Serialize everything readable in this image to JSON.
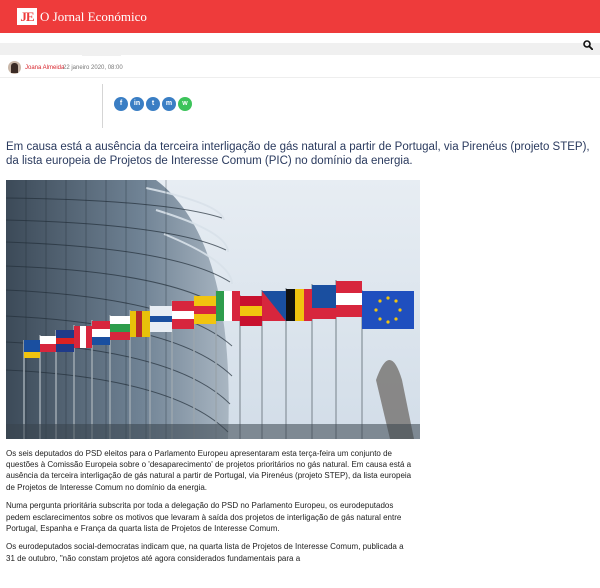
{
  "site": {
    "logo_mark": "JE",
    "name": "O Jornal Económico",
    "brand_color": "#ee3b3b"
  },
  "header": {
    "search_icon": "search-icon"
  },
  "article": {
    "author": "Joana Almeida",
    "date": "22 janeiro 2020, 08:00",
    "share": [
      {
        "icon": "facebook-icon",
        "glyph": "f"
      },
      {
        "icon": "linkedin-icon",
        "glyph": "in"
      },
      {
        "icon": "twitter-icon",
        "glyph": "t"
      },
      {
        "icon": "messenger-icon",
        "glyph": "m"
      },
      {
        "icon": "whatsapp-icon",
        "glyph": "w"
      }
    ],
    "lead": "Em causa está a ausência da terceira interligação de gás natural a partir de Portugal, via Pirenéus (projeto STEP), da lista europeia de Projetos de Interesse Comum (PIC) no domínio da energia.",
    "paragraphs": [
      "Os seis deputados do PSD eleitos para o Parlamento Europeu apresentaram esta terça-feira um conjunto de questões à Comissão Europeia sobre o 'desaparecimento' de projetos prioritários no gás natural. Em causa está a ausência da terceira interligação de gás natural a partir de Portugal, via Pirenéus (projeto STEP), da lista europeia de Projetos de Interesse Comum no domínio da energia.",
      "Numa pergunta prioritária subscrita por toda a delegação do PSD no Parlamento Europeu, os eurodeputados pedem esclarecimentos sobre os motivos que levaram à saída dos projetos de interligação de gás natural entre Portugal, Espanha e França da quarta lista de Projetos de Interesse Comum.",
      "Os eurodeputados social-democratas indicam que, na quarta lista de Projetos de Interesse Comum, publicada a 31 de outubro, \"não constam projetos até agora considerados fundamentais para a"
    ]
  }
}
